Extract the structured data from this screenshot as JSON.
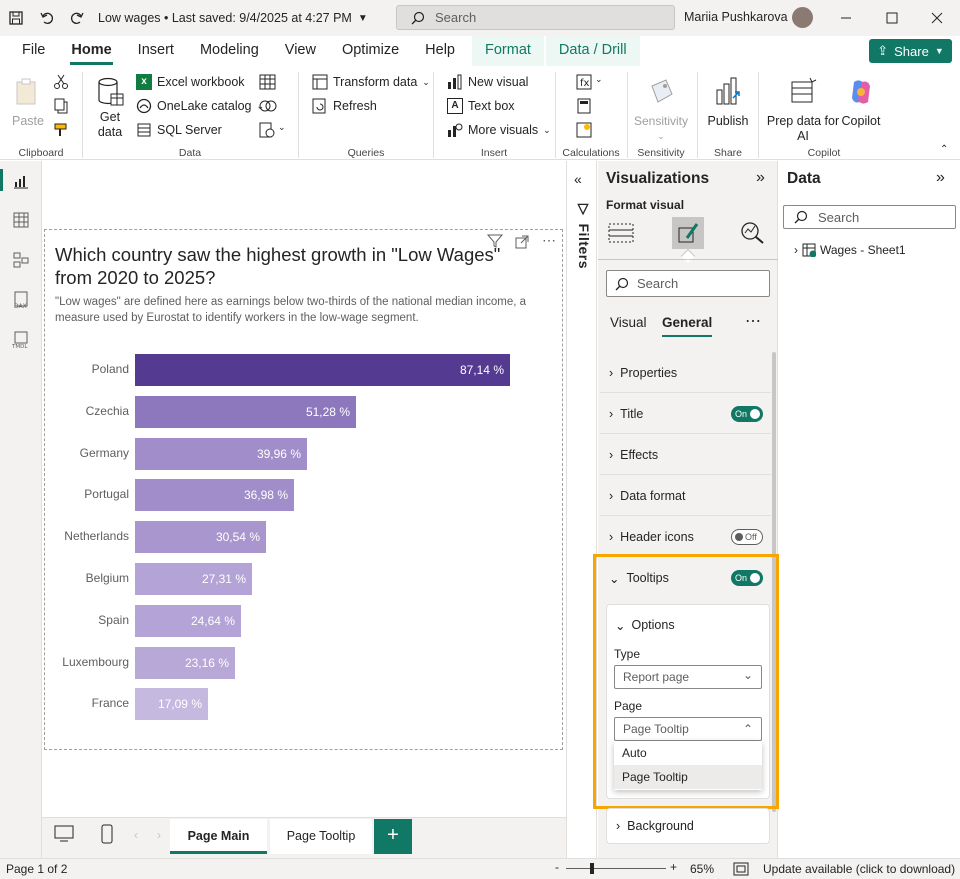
{
  "titlebar": {
    "title": "Low wages • Last saved: 9/4/2025 at 4:27 PM",
    "search_placeholder": "Search",
    "user": "Mariia Pushkarova"
  },
  "tabs": [
    "File",
    "Home",
    "Insert",
    "Modeling",
    "View",
    "Optimize",
    "Help",
    "Format",
    "Data / Drill"
  ],
  "share_label": "Share",
  "ribbon": {
    "clipboard": {
      "paste": "Paste",
      "label": "Clipboard"
    },
    "data": {
      "get_data": "Get data",
      "excel": "Excel workbook",
      "onelake": "OneLake catalog",
      "sql": "SQL Server",
      "label": "Data"
    },
    "queries": {
      "transform": "Transform data",
      "refresh": "Refresh",
      "label": "Queries"
    },
    "insert": {
      "new_visual": "New visual",
      "text_box": "Text box",
      "more_visuals": "More visuals",
      "label": "Insert"
    },
    "calculations": {
      "label": "Calculations"
    },
    "sensitivity": {
      "btn": "Sensitivity",
      "label": "Sensitivity"
    },
    "share": {
      "publish": "Publish",
      "label": "Share"
    },
    "copilot": {
      "prep": "Prep data for AI",
      "copilot": "Copilot",
      "label": "Copilot"
    }
  },
  "chart_data": {
    "type": "bar",
    "title": "Which country saw the highest growth in \"Low Wages\" from 2020 to 2025?",
    "subtitle": "\"Low wages\" are defined here as earnings below two-thirds of the national median income, a measure used by Eurostat to identify workers in the low-wage segment.",
    "categories": [
      "Poland",
      "Czechia",
      "Germany",
      "Portugal",
      "Netherlands",
      "Belgium",
      "Spain",
      "Luxembourg",
      "France"
    ],
    "values": [
      87.14,
      51.28,
      39.96,
      36.98,
      30.54,
      27.31,
      24.64,
      23.16,
      17.09
    ],
    "labels": [
      "87,14 %",
      "51,28 %",
      "39,96 %",
      "36,98 %",
      "30,54 %",
      "27,31 %",
      "24,64 %",
      "23,16 %",
      "17,09 %"
    ],
    "colors": [
      "#553a91",
      "#8e78bd",
      "#a08dc9",
      "#a08dc9",
      "#a996cf",
      "#b3a3d6",
      "#b3a3d6",
      "#b8a8d8",
      "#c6b9e0"
    ],
    "xlim": [
      0,
      100
    ],
    "grid": false
  },
  "filters_label": "Filters",
  "viz": {
    "title": "Visualizations",
    "format_visual": "Format visual",
    "search_placeholder": "Search",
    "subtabs": [
      "Visual",
      "General"
    ],
    "cards": {
      "properties": "Properties",
      "title": "Title",
      "effects": "Effects",
      "data_format": "Data format",
      "header_icons": "Header icons",
      "tooltips": "Tooltips",
      "background": "Background"
    },
    "toggle_on": "On",
    "toggle_off": "Off",
    "options": "Options",
    "type_label": "Type",
    "type_value": "Report page",
    "page_label": "Page",
    "page_value": "Page Tooltip",
    "page_options": [
      "Auto",
      "Page Tooltip"
    ]
  },
  "data_pane": {
    "title": "Data",
    "search_placeholder": "Search",
    "table": "Wages - Sheet1"
  },
  "pages": [
    "Page Main",
    "Page Tooltip"
  ],
  "status": {
    "page": "Page 1 of 2",
    "zoom": "65%",
    "update": "Update available (click to download)"
  },
  "accent": "#117865",
  "highlight_color": "#f7a600"
}
